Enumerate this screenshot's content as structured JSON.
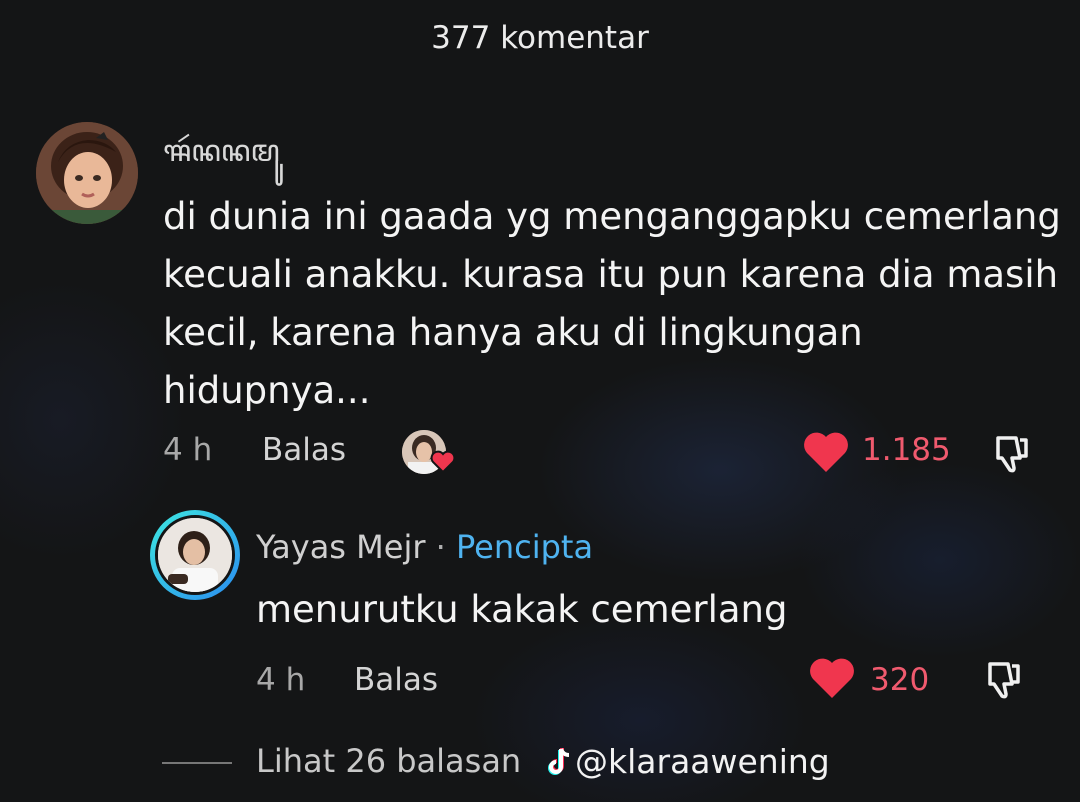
{
  "header": {
    "title": "377 komentar"
  },
  "comment": {
    "username": "ꦯꦂꦤꦤꦩꦸ",
    "text": "di dunia ini gaada yg menganggapku cemerlang kecuali anakku. kurasa itu pun karena dia masih kecil, karena hanya aku di lingkungan hidupnya...",
    "time": "4 h",
    "reply_label": "Balas",
    "like_count": "1.185"
  },
  "reply": {
    "username": "Yayas Mejr",
    "separator": "·",
    "creator_tag": "Pencipta",
    "text": "menurutku kakak cemerlang",
    "time": "4 h",
    "reply_label": "Balas",
    "like_count": "320"
  },
  "view_replies": {
    "label": "Lihat 26 balasan"
  },
  "watermark": {
    "handle": "@klaraawening"
  },
  "colors": {
    "like": "#f0364e",
    "creator": "#4fb3f0",
    "ring_start": "#3ee8e0",
    "ring_end": "#2a8cf0"
  }
}
